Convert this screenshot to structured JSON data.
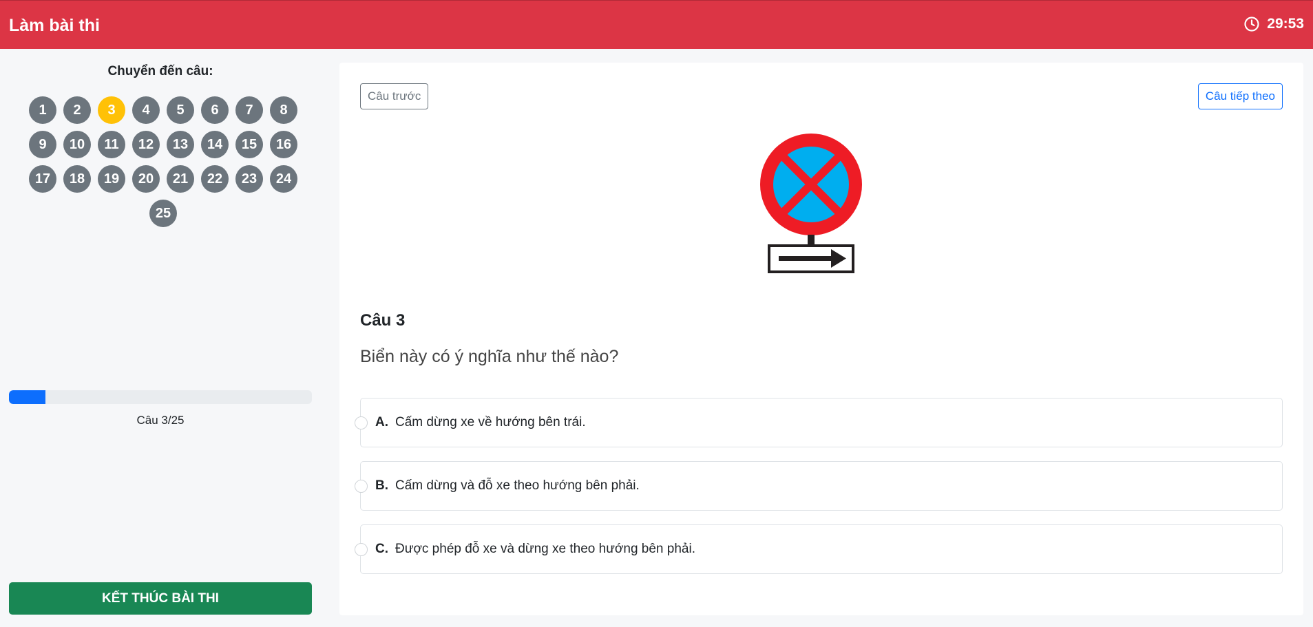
{
  "header": {
    "title": "Làm bài thi",
    "timer": "29:53",
    "timer_icon": "clock-icon"
  },
  "sidebar": {
    "jump_label": "Chuyển đến câu:",
    "questions": [
      "1",
      "2",
      "3",
      "4",
      "5",
      "6",
      "7",
      "8",
      "9",
      "10",
      "11",
      "12",
      "13",
      "14",
      "15",
      "16",
      "17",
      "18",
      "19",
      "20",
      "21",
      "22",
      "23",
      "24",
      "25"
    ],
    "active_question": "3",
    "progress_fraction": 0.12,
    "progress_text": "Câu 3/25",
    "finish_label": "KẾT THÚC BÀI THI"
  },
  "main": {
    "prev_label": "Câu trước",
    "next_label": "Câu tiếp theo",
    "question_title": "Câu 3",
    "question_text": "Biển này có ý nghĩa như thế nào?",
    "options": [
      {
        "letter": "A.",
        "text": "Cấm dừng xe về hướng bên trái."
      },
      {
        "letter": "B.",
        "text": "Cấm dừng và đỗ xe theo hướng bên phải."
      },
      {
        "letter": "C.",
        "text": "Được phép đỗ xe và dừng xe theo hướng bên phải."
      }
    ]
  },
  "colors": {
    "header": "#dc3545",
    "active_question": "#ffc107",
    "question_default": "#6c757d",
    "progress": "#0d6efd",
    "finish": "#198754"
  }
}
